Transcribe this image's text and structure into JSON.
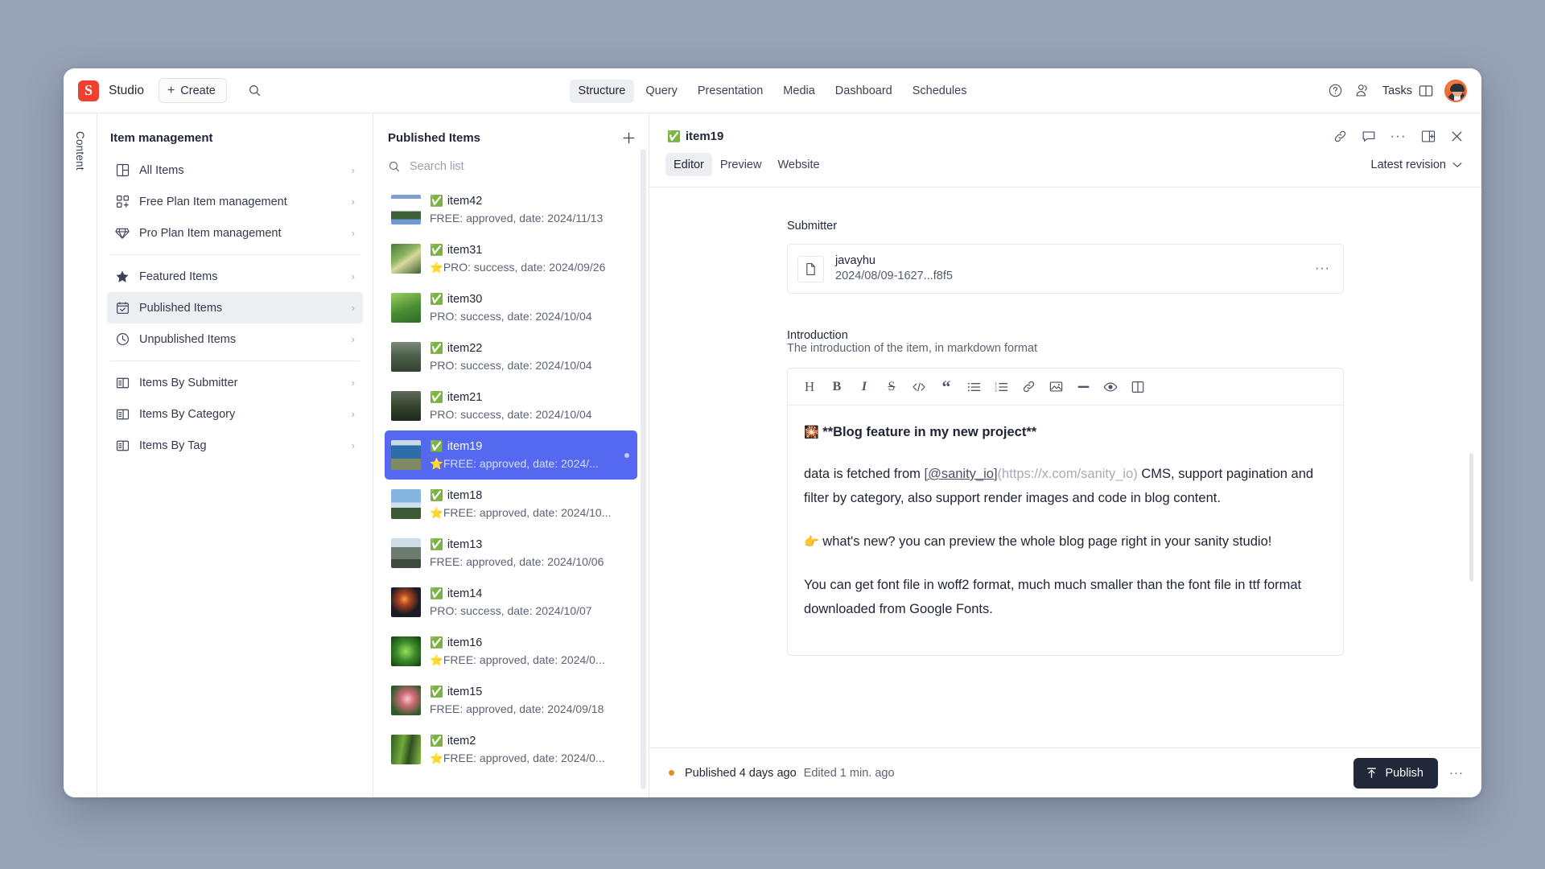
{
  "topbar": {
    "logo_letter": "S",
    "studio_name": "Studio",
    "create_label": "Create",
    "search_icon": "search-icon",
    "nav_tabs": [
      {
        "label": "Structure",
        "active": true
      },
      {
        "label": "Query",
        "active": false
      },
      {
        "label": "Presentation",
        "active": false
      },
      {
        "label": "Media",
        "active": false
      },
      {
        "label": "Dashboard",
        "active": false
      },
      {
        "label": "Schedules",
        "active": false
      }
    ],
    "help_icon": "help-circle-icon",
    "members_icon": "members-icon",
    "tasks_label": "Tasks",
    "tasks_panel_icon": "panel-icon",
    "avatar_name": "user-avatar"
  },
  "rail": {
    "label": "Content"
  },
  "structure": {
    "title": "Item management",
    "items": [
      {
        "label": "All Items",
        "icon": "layout-grid-icon",
        "active": false,
        "sep_after": false
      },
      {
        "label": "Free Plan Item management",
        "icon": "add-square-icon",
        "active": false,
        "sep_after": false
      },
      {
        "label": "Pro Plan Item management",
        "icon": "diamond-icon",
        "active": false,
        "sep_after": true
      },
      {
        "label": "Featured Items",
        "icon": "star-icon",
        "active": false,
        "sep_after": false
      },
      {
        "label": "Published Items",
        "icon": "calendar-check-icon",
        "active": true,
        "sep_after": false
      },
      {
        "label": "Unpublished Items",
        "icon": "clock-icon",
        "active": false,
        "sep_after": true
      },
      {
        "label": "Items By Submitter",
        "icon": "table-icon",
        "active": false,
        "sep_after": false
      },
      {
        "label": "Items By Category",
        "icon": "table-icon",
        "active": false,
        "sep_after": false
      },
      {
        "label": "Items By Tag",
        "icon": "table-icon",
        "active": false,
        "sep_after": false
      }
    ]
  },
  "list": {
    "title": "Published Items",
    "add_icon": "plus-icon",
    "search_placeholder": "Search list",
    "search_value": "",
    "selected_color": "#5468f0",
    "items": [
      {
        "title": "item42",
        "status_emoji": "✅",
        "subtitle": "FREE: approved, date: 2024/11/13",
        "star": false,
        "selected": false,
        "thumb": "web-page",
        "unsaved": false
      },
      {
        "title": "item31",
        "status_emoji": "✅",
        "subtitle": "PRO: success, date: 2024/09/26",
        "star": true,
        "selected": false,
        "thumb": "forest-road",
        "unsaved": false
      },
      {
        "title": "item30",
        "status_emoji": "✅",
        "subtitle": "PRO: success, date: 2024/10/04",
        "star": false,
        "selected": false,
        "thumb": "green-field",
        "unsaved": false
      },
      {
        "title": "item22",
        "status_emoji": "✅",
        "subtitle": "PRO: success, date: 2024/10/04",
        "star": false,
        "selected": false,
        "thumb": "waterfall",
        "unsaved": false
      },
      {
        "title": "item21",
        "status_emoji": "✅",
        "subtitle": "PRO: success, date: 2024/10/04",
        "star": false,
        "selected": false,
        "thumb": "dark-forest",
        "unsaved": false
      },
      {
        "title": "item19",
        "status_emoji": "✅",
        "subtitle": "FREE: approved, date: 2024/...",
        "star": true,
        "selected": true,
        "thumb": "coastline",
        "unsaved": true
      },
      {
        "title": "item18",
        "status_emoji": "✅",
        "subtitle": "FREE: approved, date: 2024/10...",
        "star": true,
        "selected": false,
        "thumb": "sky-hill",
        "unsaved": false
      },
      {
        "title": "item13",
        "status_emoji": "✅",
        "subtitle": "FREE: approved, date: 2024/10/06",
        "star": false,
        "selected": false,
        "thumb": "cliff",
        "unsaved": false
      },
      {
        "title": "item14",
        "status_emoji": "✅",
        "subtitle": "PRO: success, date: 2024/10/07",
        "star": false,
        "selected": false,
        "thumb": "night-fire",
        "unsaved": false
      },
      {
        "title": "item16",
        "status_emoji": "✅",
        "subtitle": "FREE: approved, date: 2024/0...",
        "star": true,
        "selected": false,
        "thumb": "green-burst",
        "unsaved": false
      },
      {
        "title": "item15",
        "status_emoji": "✅",
        "subtitle": "FREE: approved, date: 2024/09/18",
        "star": false,
        "selected": false,
        "thumb": "pink-flower",
        "unsaved": false
      },
      {
        "title": "item2",
        "status_emoji": "✅",
        "subtitle": "FREE: approved, date: 2024/0...",
        "star": true,
        "selected": false,
        "thumb": "bamboo",
        "unsaved": false
      }
    ]
  },
  "document": {
    "title": "item19",
    "title_emoji": "✅",
    "header_icons": [
      "link-icon",
      "comment-icon",
      "more-icon",
      "split-pane-icon",
      "close-icon"
    ],
    "tabs": [
      {
        "label": "Editor",
        "active": true
      },
      {
        "label": "Preview",
        "active": false
      },
      {
        "label": "Website",
        "active": false
      }
    ],
    "revision_label": "Latest revision",
    "fields": {
      "submitter": {
        "label": "Submitter",
        "ref_name": "javayhu",
        "ref_id": "2024/08/09-1627...f8f5",
        "ref_icon": "document-icon",
        "more_icon": "more-icon"
      },
      "introduction": {
        "label": "Introduction",
        "description": "The introduction of the item, in markdown format",
        "toolbar": [
          {
            "name": "heading-icon",
            "glyph": "H"
          },
          {
            "name": "bold-icon",
            "glyph": "B"
          },
          {
            "name": "italic-icon",
            "glyph": "I"
          },
          {
            "name": "strikethrough-icon",
            "glyph": "S"
          },
          {
            "name": "code-icon",
            "glyph": "</>"
          },
          {
            "name": "quote-icon",
            "glyph": "“"
          },
          {
            "name": "bullet-list-icon",
            "glyph": "list"
          },
          {
            "name": "numbered-list-icon",
            "glyph": "nlist"
          },
          {
            "name": "link-icon",
            "glyph": "link"
          },
          {
            "name": "image-icon",
            "glyph": "image"
          },
          {
            "name": "horizontal-rule-icon",
            "glyph": "hr"
          },
          {
            "name": "preview-eye-icon",
            "glyph": "eye"
          },
          {
            "name": "split-view-icon",
            "glyph": "split"
          }
        ],
        "content": {
          "heading_emoji": "🎇",
          "heading": "**Blog feature in my new project**",
          "para1_before": "data is fetched from ",
          "para1_link": "[@sanity_io]",
          "para1_url": "(https://x.com/sanity_io)",
          "para1_after": " CMS, support pagination and filter by category, also support render images and code in blog content.",
          "para2_emoji": "👉",
          "para2": "what's new? you can preview the whole blog page right in your sanity studio!",
          "para3": "You can get font file in woff2 format, much much smaller than the font file in ttf format downloaded from Google Fonts."
        }
      }
    },
    "footer": {
      "status_text": "Published 4 days ago",
      "edited_text": "Edited 1 min. ago",
      "status_color": "#e98b23",
      "publish_label": "Publish",
      "publish_icon": "publish-up-icon",
      "more_icon": "more-icon"
    }
  }
}
